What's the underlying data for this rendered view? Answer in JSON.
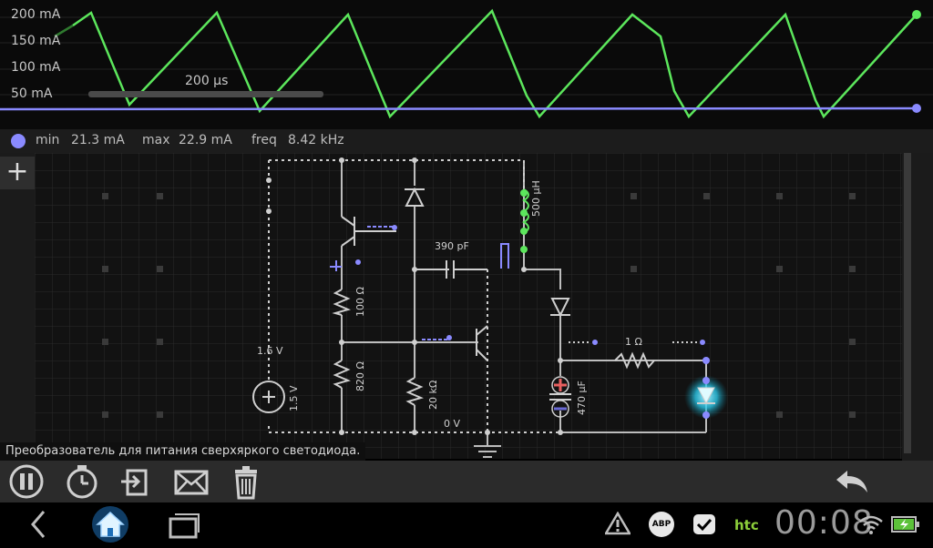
{
  "scope": {
    "y_labels": [
      "200 mA",
      "150 mA",
      "100 mA",
      "50 mA"
    ],
    "time_scale": "200 µs",
    "current_trace_color": "#5ce65c",
    "voltage_trace_color": "#8a8aff"
  },
  "stats": {
    "min_label": "min",
    "min_value": "21.3 mA",
    "max_label": "max",
    "max_value": "22.9 mA",
    "freq_label": "freq",
    "freq_value": "8.42 kHz"
  },
  "circuit": {
    "capacitor_label": "390 pF",
    "inductor_label": "500 µH",
    "resistor_100": "100 Ω",
    "resistor_820": "820 Ω",
    "resistor_20k": "20 kΩ",
    "resistor_1": "1 Ω",
    "cap_470": "470 µF",
    "battery_label": "1.5 V",
    "node_voltage": "1.6 V",
    "ground_label": "0 V"
  },
  "caption": "Преобразователь для питания сверхяркого светодиода.",
  "toolbar": {
    "icons": [
      "pause-icon",
      "stopwatch-icon",
      "export-icon",
      "mail-icon",
      "trash-icon",
      "undo-icon"
    ]
  },
  "system": {
    "clock": "00:08",
    "brand": "htc",
    "abp": "ABP"
  }
}
